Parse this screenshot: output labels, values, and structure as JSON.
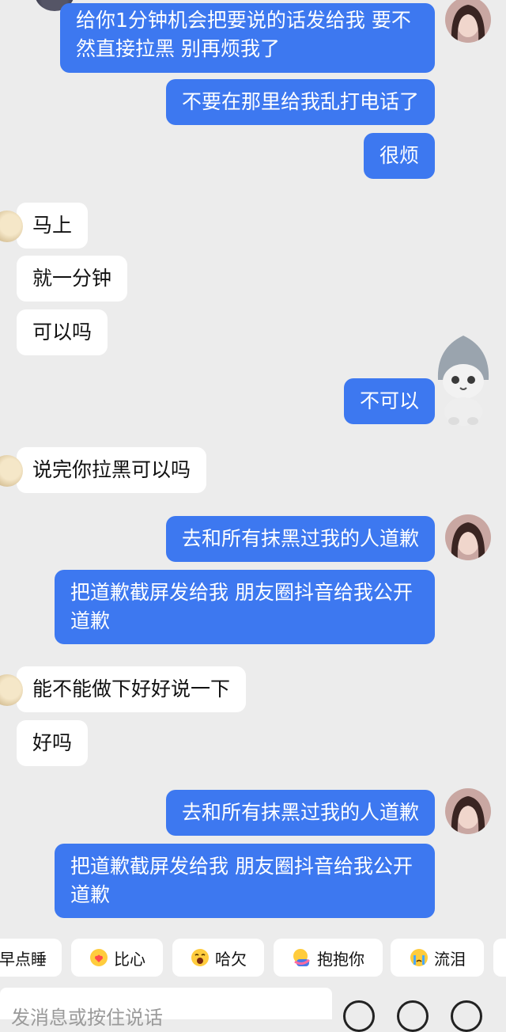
{
  "messages": [
    {
      "side": "out",
      "text": "给你1分钟机会把要说的话发给我 要不然直接拉黑 别再烦我了"
    },
    {
      "side": "out",
      "text": "不要在那里给我乱打电话了"
    },
    {
      "side": "out",
      "text": "很烦"
    },
    {
      "side": "in",
      "text": "马上"
    },
    {
      "side": "in",
      "text": "就一分钟"
    },
    {
      "side": "in",
      "text": "可以吗"
    },
    {
      "side": "out",
      "text": "不可以"
    },
    {
      "side": "in",
      "text": "说完你拉黑可以吗"
    },
    {
      "side": "out",
      "text": "去和所有抹黑过我的人道歉"
    },
    {
      "side": "out",
      "text": "把道歉截屏发给我 朋友圈抖音给我公开道歉"
    },
    {
      "side": "in",
      "text": "能不能做下好好说一下"
    },
    {
      "side": "in",
      "text": "好吗"
    },
    {
      "side": "out",
      "text": "去和所有抹黑过我的人道歉"
    },
    {
      "side": "out",
      "text": "把道歉截屏发给我 朋友圈抖音给我公开道歉"
    }
  ],
  "quick_replies": [
    {
      "label": "早点睡",
      "icon": ""
    },
    {
      "label": "比心",
      "icon": "heart-hands-emoji-icon"
    },
    {
      "label": "哈欠",
      "icon": "yawn-emoji-icon"
    },
    {
      "label": "抱抱你",
      "icon": "hug-emoji-icon"
    },
    {
      "label": "流泪",
      "icon": "crying-emoji-icon"
    }
  ],
  "input": {
    "placeholder": "发消息或按住说话"
  },
  "colors": {
    "outgoing": "#3d78f0",
    "incoming": "#ffffff",
    "background": "#ececec"
  }
}
